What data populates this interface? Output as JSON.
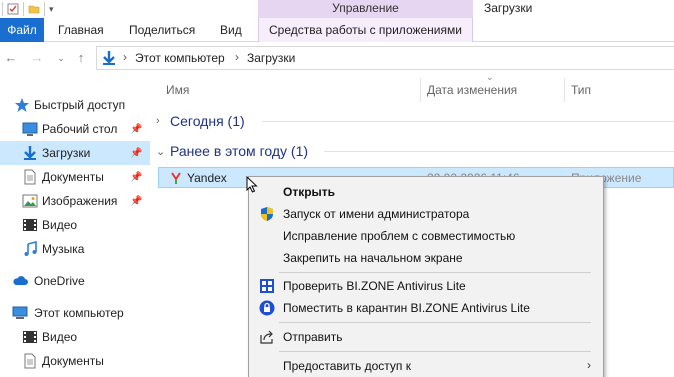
{
  "window": {
    "title": "Загрузки",
    "contextual_group": "Управление"
  },
  "ribbon": {
    "tabs": [
      "Файл",
      "Главная",
      "Поделиться",
      "Вид",
      "Средства работы с приложениями"
    ]
  },
  "address": {
    "crumbs": [
      "Этот компьютер",
      "Загрузки"
    ]
  },
  "navigation": {
    "items": [
      {
        "label": "Быстрый доступ",
        "icon": "star-icon"
      },
      {
        "label": "Рабочий стол",
        "icon": "desktop-icon",
        "pinned": true
      },
      {
        "label": "Загрузки",
        "icon": "download-icon",
        "pinned": true,
        "selected": true
      },
      {
        "label": "Документы",
        "icon": "documents-icon",
        "pinned": true
      },
      {
        "label": "Изображения",
        "icon": "pictures-icon",
        "pinned": true
      },
      {
        "label": "Видео",
        "icon": "video-icon"
      },
      {
        "label": "Музыка",
        "icon": "music-icon"
      },
      {
        "label": "OneDrive",
        "icon": "cloud-icon"
      },
      {
        "label": "Этот компьютер",
        "icon": "computer-icon"
      },
      {
        "label": "Видео",
        "icon": "video-icon"
      },
      {
        "label": "Документы",
        "icon": "documents-icon"
      }
    ]
  },
  "columns": {
    "name": "Имя",
    "date": "Дата изменения",
    "type": "Тип"
  },
  "groups": {
    "today": "Сегодня (1)",
    "earlier": "Ранее в этом году (1)"
  },
  "file": {
    "name": "Yandex",
    "date": "22.02.2026 11:46",
    "type": "Приложение"
  },
  "context_menu": {
    "items": [
      {
        "label": "Открыть",
        "bold": true
      },
      {
        "label": "Запуск от имени администратора",
        "icon": "shield-icon"
      },
      {
        "label": "Исправление проблем с совместимостью"
      },
      {
        "label": "Закрепить на начальном экране"
      },
      {
        "label": "Проверить BI.ZONE Antivirus Lite",
        "icon": "scan-icon"
      },
      {
        "label": "Поместить в карантин BI.ZONE Antivirus Lite",
        "icon": "lock-icon"
      },
      {
        "label": "Отправить",
        "icon": "share-icon"
      },
      {
        "label": "Предоставить доступ к",
        "submenu": true
      }
    ]
  },
  "colors": {
    "accent": "#1a6ecf",
    "selection": "#cce8ff",
    "group_header": "#1e3287",
    "contextual_tab": "#e7d6f1"
  }
}
